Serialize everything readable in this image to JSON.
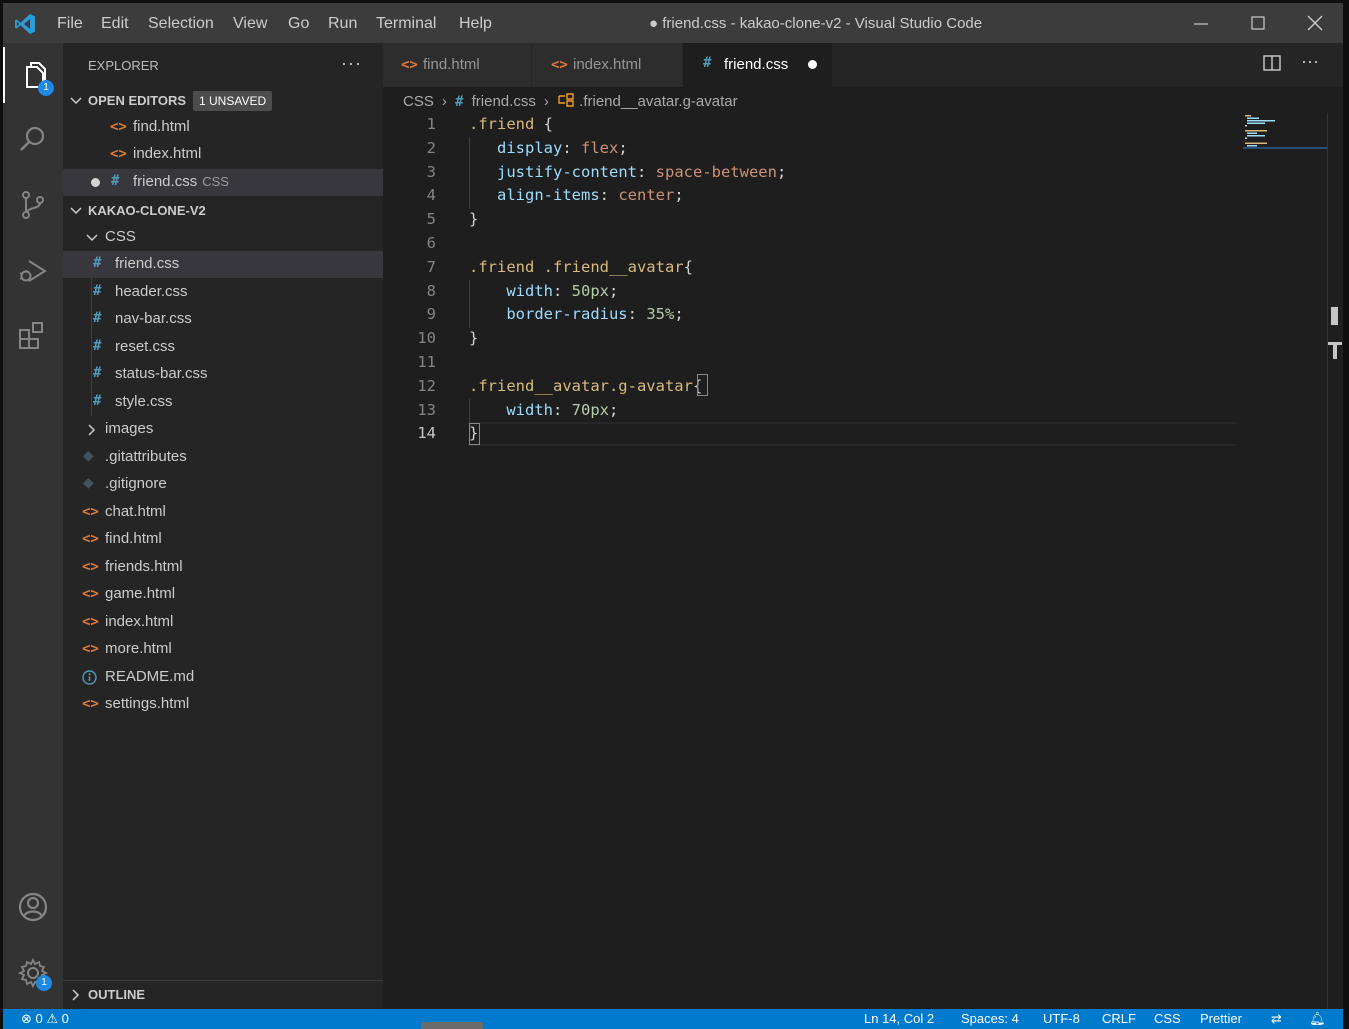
{
  "window": {
    "title": "● friend.css - kakao-clone-v2 - Visual Studio Code",
    "menu": [
      "File",
      "Edit",
      "Selection",
      "View",
      "Go",
      "Run",
      "Terminal",
      "Help"
    ]
  },
  "activity_bar": {
    "explorer_badge": "1",
    "settings_badge": "1",
    "icons": [
      "files-icon",
      "search-icon",
      "source-control-icon",
      "run-debug-icon",
      "extensions-icon",
      "account-icon",
      "settings-gear-icon"
    ]
  },
  "sidebar": {
    "title": "EXPLORER",
    "more": "···",
    "open_editors": {
      "label": "OPEN EDITORS",
      "badge": "1 UNSAVED",
      "items": [
        {
          "name": "find.html",
          "type": "html"
        },
        {
          "name": "index.html",
          "type": "html"
        },
        {
          "name": "friend.css",
          "desc": "CSS",
          "type": "css",
          "dirty": true
        }
      ]
    },
    "project": {
      "label": "KAKAO-CLONE-V2",
      "css_folder": "CSS",
      "css_files": [
        "friend.css",
        "header.css",
        "nav-bar.css",
        "reset.css",
        "status-bar.css",
        "style.css"
      ],
      "images_folder": "images",
      "root_files": [
        {
          "name": ".gitattributes",
          "type": "git"
        },
        {
          "name": ".gitignore",
          "type": "git"
        },
        {
          "name": "chat.html",
          "type": "html"
        },
        {
          "name": "find.html",
          "type": "html"
        },
        {
          "name": "friends.html",
          "type": "html"
        },
        {
          "name": "game.html",
          "type": "html"
        },
        {
          "name": "index.html",
          "type": "html"
        },
        {
          "name": "more.html",
          "type": "html"
        },
        {
          "name": "README.md",
          "type": "info"
        },
        {
          "name": "settings.html",
          "type": "html"
        }
      ]
    },
    "outline_label": "OUTLINE"
  },
  "tabs": [
    {
      "label": "find.html",
      "icon": "<>",
      "active": false
    },
    {
      "label": "index.html",
      "icon": "<>",
      "active": false
    },
    {
      "label": "friend.css",
      "icon": "#",
      "active": true,
      "dirty": true
    }
  ],
  "breadcrumb": [
    "CSS",
    "friend.css",
    ".friend__avatar.g-avatar"
  ],
  "code": {
    "line_numbers": [
      "1",
      "2",
      "3",
      "4",
      "5",
      "6",
      "7",
      "8",
      "9",
      "10",
      "11",
      "12",
      "13",
      "14"
    ],
    "lines": [
      [
        {
          "t": ".friend",
          "c": "sel"
        },
        {
          "t": " {",
          "c": "punc"
        }
      ],
      [
        {
          "t": "   ",
          "c": "punc"
        },
        {
          "t": "display",
          "c": "prop"
        },
        {
          "t": ": ",
          "c": "punc"
        },
        {
          "t": "flex",
          "c": "val"
        },
        {
          "t": ";",
          "c": "punc"
        }
      ],
      [
        {
          "t": "   ",
          "c": "punc"
        },
        {
          "t": "justify-content",
          "c": "prop"
        },
        {
          "t": ": ",
          "c": "punc"
        },
        {
          "t": "space-between",
          "c": "val"
        },
        {
          "t": ";",
          "c": "punc"
        }
      ],
      [
        {
          "t": "   ",
          "c": "punc"
        },
        {
          "t": "align-items",
          "c": "prop"
        },
        {
          "t": ": ",
          "c": "punc"
        },
        {
          "t": "center",
          "c": "val"
        },
        {
          "t": ";",
          "c": "punc"
        }
      ],
      [
        {
          "t": "}",
          "c": "punc"
        }
      ],
      [],
      [
        {
          "t": ".friend .friend__avatar",
          "c": "sel"
        },
        {
          "t": "{",
          "c": "punc"
        }
      ],
      [
        {
          "t": "    ",
          "c": "punc"
        },
        {
          "t": "width",
          "c": "prop"
        },
        {
          "t": ": ",
          "c": "punc"
        },
        {
          "t": "50px",
          "c": "num"
        },
        {
          "t": ";",
          "c": "punc"
        }
      ],
      [
        {
          "t": "    ",
          "c": "punc"
        },
        {
          "t": "border-radius",
          "c": "prop"
        },
        {
          "t": ": ",
          "c": "punc"
        },
        {
          "t": "35%",
          "c": "num"
        },
        {
          "t": ";",
          "c": "punc"
        }
      ],
      [
        {
          "t": "}",
          "c": "punc"
        }
      ],
      [],
      [
        {
          "t": ".friend__avatar.g-avatar",
          "c": "sel"
        },
        {
          "t": "{",
          "c": "punc"
        }
      ],
      [
        {
          "t": "    ",
          "c": "punc"
        },
        {
          "t": "width",
          "c": "prop"
        },
        {
          "t": ": ",
          "c": "punc"
        },
        {
          "t": "70px",
          "c": "num"
        },
        {
          "t": ";",
          "c": "punc"
        }
      ],
      [
        {
          "t": "}",
          "c": "punc"
        }
      ]
    ],
    "active_line": "14"
  },
  "status_bar": {
    "errors": "0",
    "warnings": "0",
    "position": "Ln 14, Col 2",
    "spaces": "Spaces: 4",
    "encoding": "UTF-8",
    "eol": "CRLF",
    "language": "CSS",
    "formatter": "Prettier"
  },
  "colors": {
    "status_bar": "#007acc",
    "selector": "#d7ba7d",
    "property": "#9cdcfe",
    "value": "#ce9178",
    "number": "#b5cea8"
  }
}
